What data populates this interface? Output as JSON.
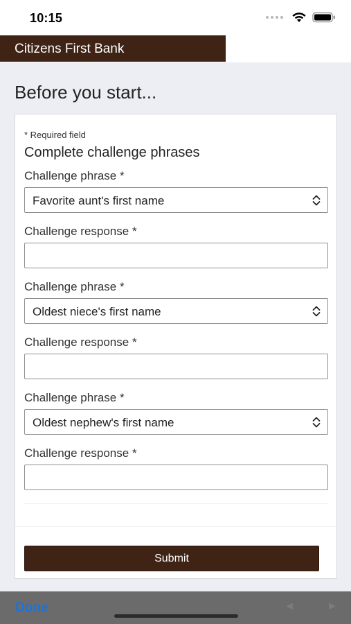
{
  "status_bar": {
    "time": "10:15",
    "icons": [
      "signal-dots-icon",
      "wifi-icon",
      "battery-icon"
    ]
  },
  "header": {
    "bank_name": "Citizens First Bank",
    "brand_color": "#3f2314"
  },
  "page": {
    "title": "Before you start..."
  },
  "form": {
    "required_note": "* Required field",
    "section_title": "Complete challenge phrases",
    "pairs": [
      {
        "phrase_label": "Challenge phrase *",
        "phrase_value": "Favorite aunt's first name",
        "response_label": "Challenge response *",
        "response_value": ""
      },
      {
        "phrase_label": "Challenge phrase *",
        "phrase_value": "Oldest niece's first name",
        "response_label": "Challenge response *",
        "response_value": ""
      },
      {
        "phrase_label": "Challenge phrase *",
        "phrase_value": "Oldest nephew's first name",
        "response_label": "Challenge response *",
        "response_value": ""
      }
    ],
    "submit_label": "Submit"
  },
  "keyboard_toolbar": {
    "done_label": "Done",
    "prev_glyph": "◄",
    "next_glyph": "►",
    "done_color": "#1d73d6"
  }
}
